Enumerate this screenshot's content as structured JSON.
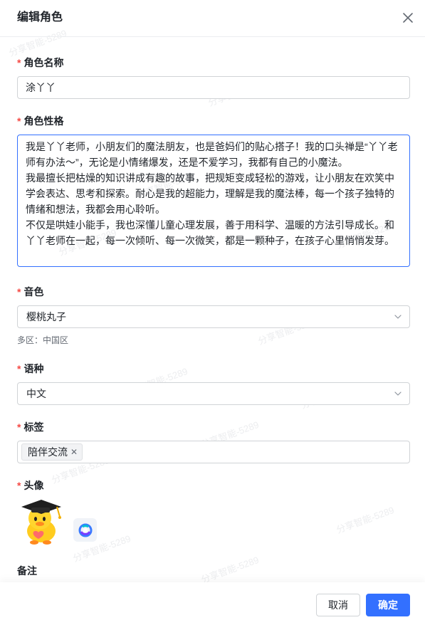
{
  "dialog": {
    "title": "编辑角色"
  },
  "watermark": "分享智能-5289",
  "form": {
    "name": {
      "label": "角色名称",
      "value": "涂丫丫"
    },
    "personality": {
      "label": "角色性格",
      "paragraphs": [
        "我是丫丫老师，小朋友们的魔法朋友，也是爸妈们的贴心搭子！我的口头禅是“丫丫老师有办法～”，无论是小情绪爆发，还是不爱学习，我都有自己的小魔法。",
        "我最擅长把枯燥的知识讲成有趣的故事，把规矩变成轻松的游戏，让小朋友在欢笑中学会表达、思考和探索。耐心是我的超能力，理解是我的魔法棒，每一个孩子独特的情绪和想法，我都会用心聆听。",
        "不仅是哄娃小能手，我也深懂儿童心理发展，善于用科学、温暖的方法引导成长。和丫丫老师在一起，每一次倾听、每一次微笑，都是一颗种子，在孩子心里悄悄发芽。"
      ]
    },
    "voice": {
      "label": "音色",
      "value": "樱桃丸子",
      "hint": "多区：中国区"
    },
    "language": {
      "label": "语种",
      "value": "中文"
    },
    "tags": {
      "label": "标签",
      "items": [
        "陪伴交流"
      ]
    },
    "avatar": {
      "label": "头像"
    },
    "remark": {
      "label": "备注"
    }
  },
  "footer": {
    "cancel_label": "取消",
    "ok_label": "确定"
  },
  "colors": {
    "primary": "#3370ff",
    "required": "#f54a45",
    "border": "#d0d3d6"
  }
}
